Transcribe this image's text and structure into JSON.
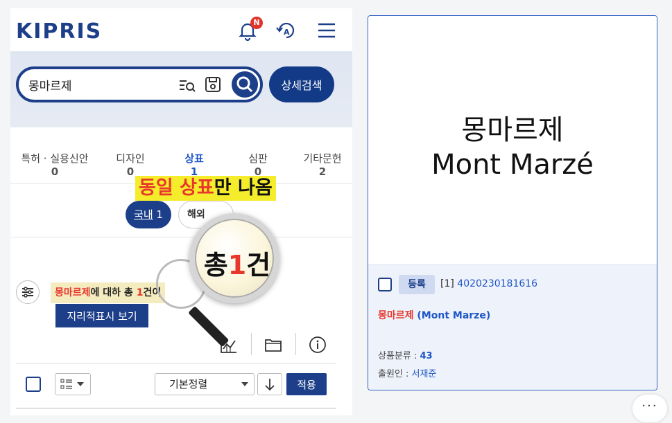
{
  "header": {
    "logo": "KIPRIS",
    "notification_badge": "N",
    "lang_icon_label": "A"
  },
  "search": {
    "query": "몽마르제",
    "detail_label": "상세검색"
  },
  "tabs": [
    {
      "label": "특허 · 실용신안",
      "count": "0"
    },
    {
      "label": "디자인",
      "count": "0"
    },
    {
      "label": "상표",
      "count": "1"
    },
    {
      "label": "심판",
      "count": "0"
    },
    {
      "label": "기타문헌",
      "count": "2"
    }
  ],
  "callout": {
    "part1": "동일 상표",
    "part2": "만 나옴"
  },
  "filters": {
    "domestic_label": "국내",
    "domestic_count": "1",
    "foreign_label": "해외"
  },
  "summary": {
    "keyword": "몽마르제",
    "text_mid": "에 대하",
    "text_total": "총",
    "count": "1",
    "unit": "건이"
  },
  "magnifier": {
    "prefix": "총",
    "count": "1",
    "suffix": "건"
  },
  "geo_button": "지리적표시 보기",
  "sort": {
    "selected": "기본정렬",
    "apply_label": "적용"
  },
  "card": {
    "mark_korean": "몽마르제",
    "mark_english": "Mont Marzé",
    "status": "등록",
    "index": "[1]",
    "application_number": "4020230181616",
    "title_korean": "몽마르제",
    "title_english": "(Mont Marze)",
    "class_label": "상품분류 :",
    "class_value": "43",
    "applicant_label": "출원인 :",
    "applicant_value": "서재준"
  },
  "more_button": "···",
  "colors": {
    "brand_navy": "#1d3f8a",
    "accent_blue": "#1e56c7",
    "highlight_red": "#e8372c",
    "highlight_yellow": "#f5ec2b"
  }
}
